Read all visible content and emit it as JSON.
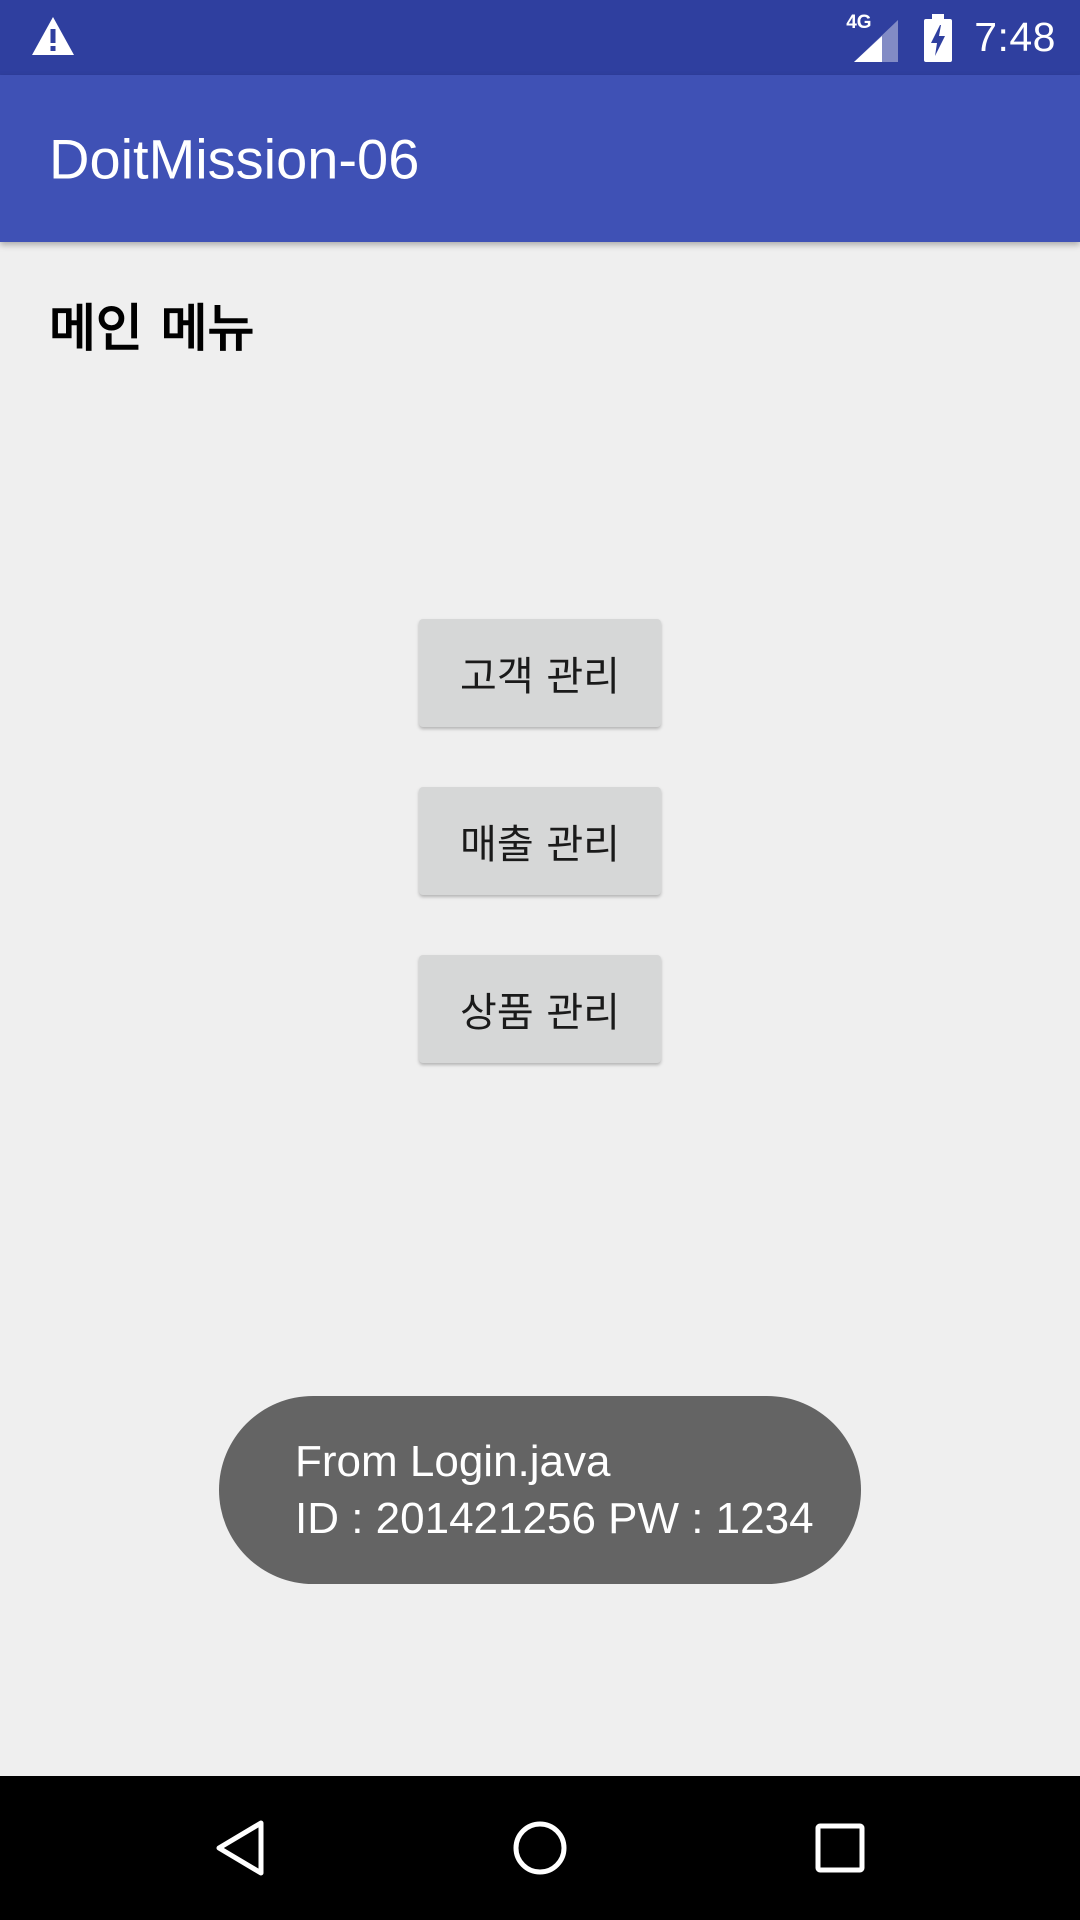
{
  "status_bar": {
    "icons": {
      "warning": "warning-icon",
      "network": "signal-4g-icon",
      "battery": "battery-charging-icon"
    },
    "network_label": "4G",
    "time": "7:48",
    "background_color": "#2f3f9f"
  },
  "app_bar": {
    "title": "DoitMission-06",
    "background_color": "#3f51b5"
  },
  "main": {
    "heading": "메인 메뉴",
    "buttons": [
      {
        "label": "고객 관리"
      },
      {
        "label": "매출 관리"
      },
      {
        "label": "상품 관리"
      }
    ],
    "background_color": "#efefef"
  },
  "toast": {
    "line1": "From Login.java",
    "line2": "ID : 201421256 PW : 1234",
    "background_color": "#646464"
  },
  "nav_bar": {
    "icons": {
      "back": "back-icon",
      "home": "home-icon",
      "recents": "recents-icon"
    },
    "background_color": "#000000"
  }
}
